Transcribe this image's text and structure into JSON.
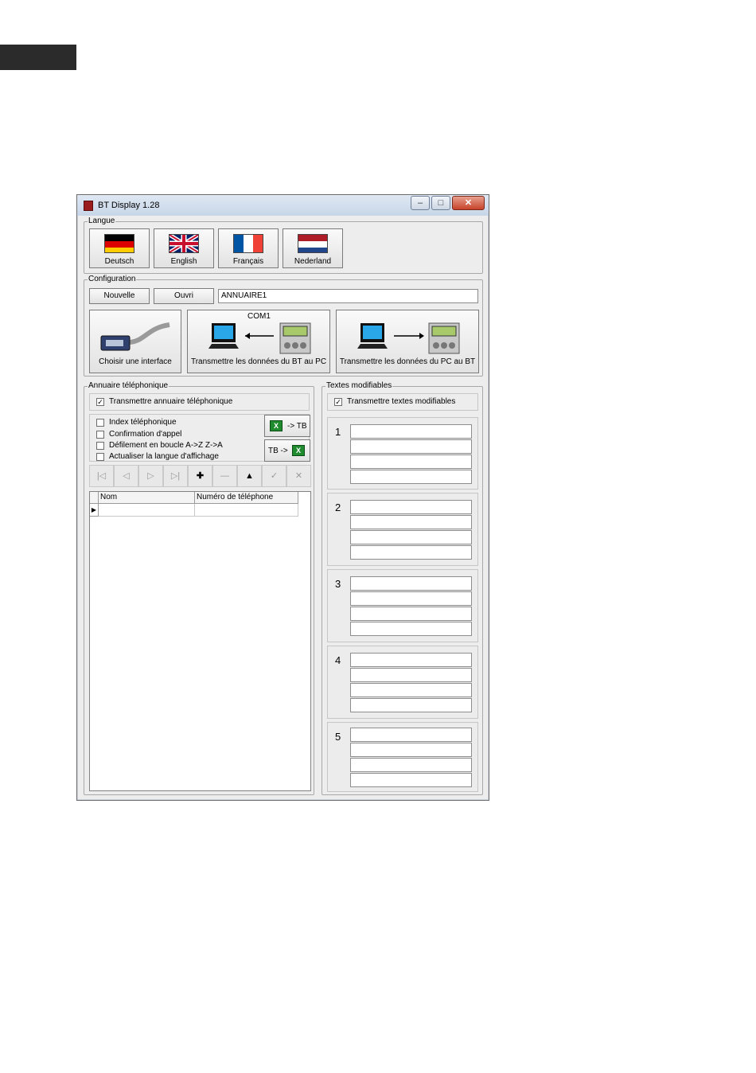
{
  "window": {
    "title": "BT Display 1.28",
    "controls": {
      "minimize": "–",
      "maximize": "□",
      "close": "✕"
    }
  },
  "langue": {
    "legend": "Langue",
    "buttons": [
      "Deutsch",
      "English",
      "Français",
      "Nederland"
    ]
  },
  "configuration": {
    "legend": "Configuration",
    "new_label": "Nouvelle",
    "open_label": "Ouvri",
    "filename": "ANNUAIRE1",
    "port_label": "COM1",
    "choose_interface": "Choisir une interface",
    "bt_to_pc": "Transmettre les données du BT au PC",
    "pc_to_bt": "Transmettre les données du PC au BT"
  },
  "annuaire": {
    "legend": "Annuaire téléphonique",
    "transmit_label": "Transmettre annuaire téléphonique",
    "transmit_checked": true,
    "options": [
      {
        "label": "Index téléphonique",
        "checked": false
      },
      {
        "label": "Confirmation d'appel",
        "checked": false
      },
      {
        "label": "Défilement en boucle A->Z Z->A",
        "checked": false
      },
      {
        "label": "Actualiser la langue d'affichage",
        "checked": false
      }
    ],
    "excel_to_tb": "-> TB",
    "tb_to_excel": "TB ->",
    "nav": [
      "|◁",
      "◁",
      "▷",
      "▷|",
      "✚",
      "—",
      "▲",
      "✓",
      "✕"
    ],
    "columns": [
      "Nom",
      "Numéro de téléphone"
    ]
  },
  "textes": {
    "legend": "Textes modifiables",
    "transmit_label": "Transmettre textes modifiables",
    "transmit_checked": true,
    "groups": [
      "1",
      "2",
      "3",
      "4",
      "5"
    ]
  },
  "colors": {
    "window_bg": "#ededed",
    "excel_green": "#1f8a2e",
    "close_red": "#c7432a"
  }
}
